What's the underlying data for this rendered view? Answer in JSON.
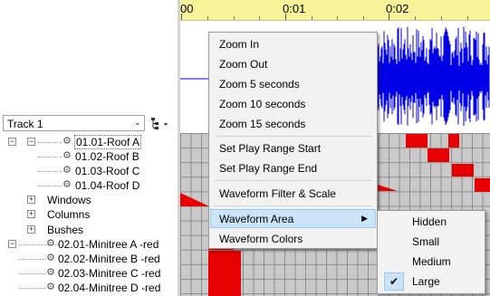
{
  "ruler": {
    "labels": [
      "00",
      "0:01",
      "0:02"
    ]
  },
  "track_selector": {
    "value": "Track 1"
  },
  "tree": {
    "rows": [
      {
        "label": "01.01-Roof A",
        "kind": "child-model",
        "expander": "−"
      },
      {
        "label": "01.02-Roof B",
        "kind": "model"
      },
      {
        "label": "01.03-Roof C",
        "kind": "model"
      },
      {
        "label": "01.04-Roof D",
        "kind": "model"
      },
      {
        "label": "Windows",
        "kind": "group",
        "expander": "+"
      },
      {
        "label": "Columns",
        "kind": "group",
        "expander": "+"
      },
      {
        "label": "Bushes",
        "kind": "group",
        "expander": "+"
      },
      {
        "label": "02.01-Minitree A -red",
        "kind": "group-model",
        "expander": "−"
      },
      {
        "label": "02.02-Minitree B -red",
        "kind": "model"
      },
      {
        "label": "02.03-Minitree C -red",
        "kind": "model"
      },
      {
        "label": "02.04-Minitree D -red",
        "kind": "model"
      }
    ]
  },
  "context_menu": {
    "items": [
      {
        "label": "Zoom In"
      },
      {
        "label": "Zoom Out"
      },
      {
        "label": "Zoom 5 seconds"
      },
      {
        "label": "Zoom 10 seconds"
      },
      {
        "label": "Zoom 15 seconds"
      },
      {
        "label": "Set Play Range Start"
      },
      {
        "label": "Set Play Range End"
      },
      {
        "label": "Waveform Filter & Scale"
      },
      {
        "label": "Waveform Area",
        "submenu": true,
        "highlighted": true
      },
      {
        "label": "Waveform Colors"
      }
    ]
  },
  "submenu": {
    "items": [
      {
        "label": "Hidden"
      },
      {
        "label": "Small"
      },
      {
        "label": "Medium"
      },
      {
        "label": "Large",
        "checked": true
      }
    ]
  },
  "colors": {
    "waveform": "#0000e6",
    "effect_red": "#e60000",
    "ruler": "#f7f49a",
    "menu_highlight": "#cce4f7"
  }
}
